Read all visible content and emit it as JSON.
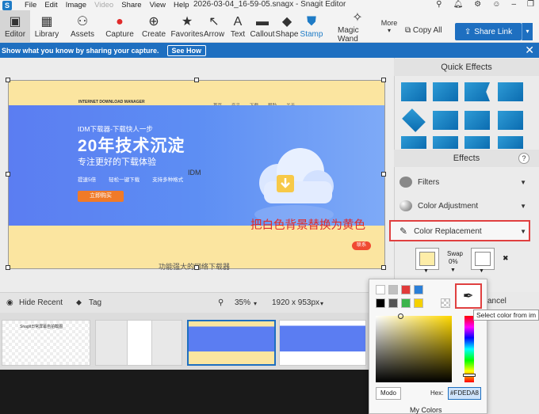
{
  "titlebar": {
    "menu": [
      "File",
      "Edit",
      "Image",
      "Video",
      "Share",
      "View",
      "Help"
    ],
    "title": "2026-03-04_16-59-05.snagx - Snagit Editor"
  },
  "toolbar": {
    "editor": "Editor",
    "library": "Library",
    "assets": "Assets",
    "capture": "Capture",
    "create": "Create",
    "favorites": "Favorites",
    "arrow": "Arrow",
    "text": "Text",
    "callout": "Callout",
    "shape": "Shape",
    "stamp": "Stamp",
    "magic_wand": "Magic Wand",
    "more": "More",
    "copy_all": "Copy All",
    "share_link": "Share Link"
  },
  "banner": {
    "text": "Show what you know by sharing your capture.",
    "button": "See How"
  },
  "capture": {
    "logo": "INTERNET DOWNLOAD MANAGER",
    "nav": [
      "首页",
      "产品",
      "下载",
      "帮助",
      "关于"
    ],
    "hero_small": "IDM下载器-下载快人一步",
    "hero_big": "20年技术沉淀",
    "hero_sub": "专注更好的下载体验",
    "features": [
      "提速5倍",
      "轻松一键下载",
      "支持多种格式"
    ],
    "hero_button": "立即购买",
    "section_title": "IDM",
    "section_sub": "功能强大的网络下载器",
    "chat": "联系"
  },
  "annotation": "把白色背景替换为黄色",
  "bottombar": {
    "hide_recent": "Hide Recent",
    "tag": "Tag",
    "zoom": "35%",
    "dimensions": "1920 x 953px"
  },
  "tray": {
    "thumb1_label": "Snagit日常屏幕自拍截图"
  },
  "rightpanel": {
    "quick_effects": "Quick Effects",
    "effects": "Effects",
    "help": "?",
    "filters": "Filters",
    "color_adjustment": "Color Adjustment",
    "color_replacement": "Color Replacement",
    "swap_label": "Swap",
    "swap_value": "0%",
    "cancel_partial": "ancel",
    "colors": {
      "from": "#FDEDA8",
      "to": "#FFFFFF"
    }
  },
  "picker": {
    "swatches": [
      "#ffffff",
      "#c0c0c0",
      "#e03a3a",
      "#2a7fd8",
      "#000000",
      "#555555",
      "#3cb44b",
      "#f5d100"
    ],
    "mode": "Modo",
    "hex_label": "Hex:",
    "hex_value": "#FDEDA8",
    "my_colors": "My Colors",
    "tooltip": "Select color from im"
  }
}
